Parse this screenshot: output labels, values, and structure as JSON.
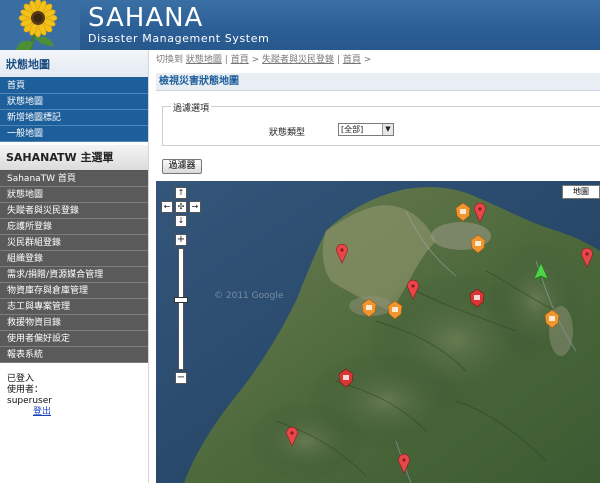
{
  "header": {
    "app_name": "SAHANA",
    "app_subtitle": "Disaster Management System"
  },
  "sidebar": {
    "section1_title": "狀態地圖",
    "section1_items": [
      "首頁",
      "狀態地圖",
      "新增地圖標記",
      "一般地圖"
    ],
    "section2_title": "SAHANATW 主選單",
    "section2_items": [
      "SahanaTW 首頁",
      "狀態地圖",
      "失蹤者與災民登錄",
      "庇護所登錄",
      "災民群組登錄",
      "組織登錄",
      "需求/捐贈/資源媒合管理",
      "物資庫存與倉庫管理",
      "志工與專案管理",
      "救援物資目錄",
      "使用者偏好設定",
      "報表系統"
    ],
    "login": {
      "logged_in": "已登入",
      "user_label": "使用者：",
      "username": "superuser",
      "logout": "登出"
    }
  },
  "main": {
    "breadcrumb": {
      "prefix": "切換到",
      "status_map": "狀態地圖",
      "sep": "|",
      "home": "首頁",
      "arrow": ">",
      "missing": "失蹤者與災民登錄",
      "home2": "首頁",
      "end": ">"
    },
    "page_title": "檢視災害狀態地圖",
    "filter": {
      "legend": "過濾選項",
      "label": "狀態類型",
      "selected": "[全部]"
    },
    "filter_button": "過濾器",
    "map": {
      "type_button": "地圖",
      "pan_up": "↑",
      "pan_left": "←",
      "pan_center": "✣",
      "pan_right": "→",
      "pan_down": "↓",
      "zoom_in": "+",
      "zoom_out": "−",
      "zoom_level": 0.42,
      "watermark": "© 2011 Google",
      "markers": [
        "red-pin",
        "red-pin",
        "red-pin",
        "red-pin",
        "red-pin",
        "red-pin",
        "red-pin",
        "orange-badge",
        "orange-badge",
        "orange-badge",
        "orange-badge",
        "orange-badge",
        "red-badge",
        "red-badge",
        "green-pin"
      ]
    }
  },
  "colors": {
    "header_bg": "#2b5e95",
    "nav_blue": "#1d5f9a",
    "nav_gray": "#5a5a5a",
    "title_blue": "#1d5f9a"
  }
}
